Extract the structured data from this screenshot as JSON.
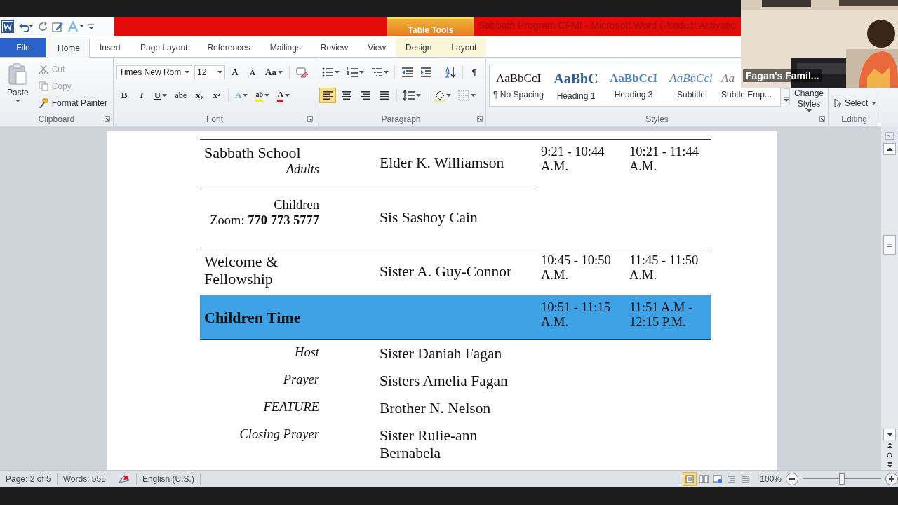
{
  "title_bar": {
    "context_tab": "Table Tools",
    "title": "Sabbath Program CFMI  -  Microsoft Word (Product Activatio"
  },
  "ribbon_tabs": [
    {
      "label": "File",
      "kind": "file",
      "selected": false
    },
    {
      "label": "Home",
      "kind": "main",
      "selected": true
    },
    {
      "label": "Insert",
      "kind": "main",
      "selected": false
    },
    {
      "label": "Page Layout",
      "kind": "main",
      "selected": false
    },
    {
      "label": "References",
      "kind": "main",
      "selected": false
    },
    {
      "label": "Mailings",
      "kind": "main",
      "selected": false
    },
    {
      "label": "Review",
      "kind": "main",
      "selected": false
    },
    {
      "label": "View",
      "kind": "main",
      "selected": false
    },
    {
      "label": "Design",
      "kind": "context",
      "selected": false
    },
    {
      "label": "Layout",
      "kind": "context",
      "selected": false
    }
  ],
  "clipboard": {
    "label": "Clipboard",
    "paste": "Paste",
    "items": [
      {
        "label": "Cut",
        "kind": "cut",
        "disabled": true
      },
      {
        "label": "Copy",
        "kind": "copy",
        "disabled": true
      },
      {
        "label": "Format Painter",
        "kind": "painter",
        "disabled": false
      }
    ]
  },
  "font": {
    "label": "Font",
    "font_name": "Times New Rom",
    "font_size": "12",
    "size_buttons": [
      {
        "glyph": "A",
        "kind": "grow"
      },
      {
        "glyph": "A",
        "kind": "shrink"
      },
      {
        "glyph": "Aa",
        "kind": "case"
      }
    ],
    "format_buttons": [
      {
        "glyph": "B",
        "kind": "bold"
      },
      {
        "glyph": "I",
        "kind": "italic"
      },
      {
        "glyph": "U",
        "kind": "underline"
      },
      {
        "glyph": "abe",
        "kind": "strike"
      },
      {
        "glyph": "x₂",
        "kind": "sub"
      },
      {
        "glyph": "x²",
        "kind": "sup"
      }
    ],
    "color_buttons": [
      {
        "glyph": "A",
        "kind": "effects"
      },
      {
        "glyph": "ab",
        "kind": "highlight"
      },
      {
        "glyph": "A",
        "kind": "color"
      }
    ]
  },
  "paragraph": {
    "label": "Paragraph",
    "marks_glyph": "¶",
    "alignment": [
      {
        "kind": "left",
        "selected": true
      },
      {
        "kind": "center",
        "selected": false
      },
      {
        "kind": "right",
        "selected": false
      },
      {
        "kind": "justify",
        "selected": false
      }
    ]
  },
  "styles": {
    "label": "Styles",
    "gallery": [
      {
        "sample": "AaBbCcI",
        "name": "¶ No Spacing",
        "kind": "normal"
      },
      {
        "sample": "AaBbC",
        "name": "Heading 1",
        "kind": "heading1"
      },
      {
        "sample": "AaBbCcI",
        "name": "Heading 3",
        "kind": "heading3"
      },
      {
        "sample": "AaBbCci",
        "name": "Subtitle",
        "kind": "subtitle"
      },
      {
        "sample": "Aa",
        "name": "Subtle Emp...",
        "kind": "emphasis"
      }
    ],
    "change_styles": "Change Styles"
  },
  "editing": {
    "label": "Editing",
    "select": "Select"
  },
  "video": {
    "kind": "picture",
    "name": "Fagan's Famil..."
  },
  "document": {
    "rows": [
      {
        "kind": "section",
        "label": "Sabbath School",
        "sublabel": "Adults",
        "person": "Elder K. Williamson",
        "time_1": "9:21 - 10:44 A.M.",
        "time_2": "10:21 - 11:44 A.M."
      },
      {
        "kind": "sub",
        "label": "Children",
        "sublabel": "Zoom: **770 773 5777**",
        "person": "Sis Sashoy Cain"
      },
      {
        "kind": "plain",
        "label": "Welcome & Fellowship",
        "person": "Sister A. Guy-Connor",
        "time_1": "10:45 - 10:50 A.M.",
        "time_2": "11:45 - 11:50 A.M."
      },
      {
        "kind": "highlight",
        "label": "Children Time",
        "time_1": "10:51 - 11:15 A.M.",
        "time_2": "11:51 A.M - 12:15 P.M."
      },
      {
        "kind": "role",
        "label": "Host",
        "person": "Sister Daniah Fagan"
      },
      {
        "kind": "role",
        "label": "Prayer",
        "person": "Sisters Amelia Fagan"
      },
      {
        "kind": "role",
        "label": "FEATURE",
        "person": "Brother N. Nelson"
      },
      {
        "kind": "role",
        "label": "Closing Prayer",
        "person": "Sister Rulie-ann Bernabela"
      }
    ]
  },
  "status_bar": {
    "page": "Page: 2 of 5",
    "words": "Words: 555",
    "language": "English (U.S.)",
    "views": [
      {
        "selected": true
      },
      {
        "selected": false
      },
      {
        "selected": false
      },
      {
        "selected": false
      },
      {
        "selected": false
      }
    ],
    "zoom": "100%",
    "zoom_slider": {
      "level": 0.5
    }
  }
}
